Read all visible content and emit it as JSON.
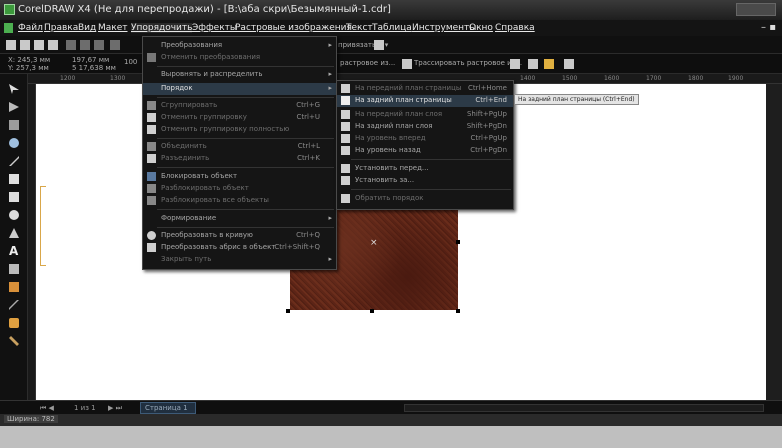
{
  "window": {
    "title": "CorelDRAW X4 (Не для перепродажи) - [B:\\аба скри\\Безымянный-1.cdr]"
  },
  "menubar": {
    "items": [
      "Файл",
      "Правка",
      "Вид",
      "Макет",
      "Упорядочить",
      "Эффекты",
      "Растровые изображения",
      "Текст",
      "Таблица",
      "Инструменты",
      "Окно",
      "Справка"
    ],
    "minimize": "– ▪"
  },
  "toolbar": {
    "x_field": "X: 245,3 мм",
    "y_field": "Y: 257,3 мм",
    "w_field": "197,67 мм",
    "h_field": "5 17,638 мм",
    "scale": "100",
    "snap_label": "привязать к ▾",
    "trace_left": "растровое из...",
    "trace_label": "Трассировать растровое из..."
  },
  "ruler": {
    "ticks": [
      "1200",
      "1300",
      "1400",
      "1500",
      "1600",
      "1700",
      "1800",
      "1900",
      "2000",
      "2100"
    ]
  },
  "arrange_menu": {
    "items": [
      {
        "label": "Преобразования",
        "shortcut": "",
        "submenu": true,
        "disabled": false
      },
      {
        "label": "Отменить преобразования",
        "shortcut": "",
        "submenu": false,
        "disabled": true
      },
      {
        "label": "Выровнять и распределить",
        "shortcut": "",
        "submenu": true,
        "disabled": false
      },
      {
        "label": "Порядок",
        "shortcut": "",
        "submenu": true,
        "disabled": false,
        "highlighted": true
      },
      {
        "label": "Сгруппировать",
        "shortcut": "Ctrl+G",
        "submenu": false,
        "disabled": true
      },
      {
        "label": "Отменить группировку",
        "shortcut": "Ctrl+U",
        "submenu": false,
        "disabled": true
      },
      {
        "label": "Отменить группировку полностью",
        "shortcut": "",
        "submenu": false,
        "disabled": true
      },
      {
        "label": "Объединить",
        "shortcut": "Ctrl+L",
        "submenu": false,
        "disabled": true
      },
      {
        "label": "Разъединить",
        "shortcut": "Ctrl+K",
        "submenu": false,
        "disabled": true
      },
      {
        "label": "Блокировать объект",
        "shortcut": "",
        "submenu": false,
        "disabled": false
      },
      {
        "label": "Разблокировать объект",
        "shortcut": "",
        "submenu": false,
        "disabled": true
      },
      {
        "label": "Разблокировать все объекты",
        "shortcut": "",
        "submenu": false,
        "disabled": true
      },
      {
        "label": "Формирование",
        "shortcut": "",
        "submenu": true,
        "disabled": false
      },
      {
        "label": "Преобразовать в кривую",
        "shortcut": "Ctrl+Q",
        "submenu": false,
        "disabled": false
      },
      {
        "label": "Преобразовать абрис в объект",
        "shortcut": "Ctrl+Shift+Q",
        "submenu": false,
        "disabled": false
      },
      {
        "label": "Закрыть путь",
        "shortcut": "",
        "submenu": true,
        "disabled": true
      }
    ]
  },
  "order_submenu": {
    "items": [
      {
        "label": "На передний план страницы",
        "shortcut": "Ctrl+Home",
        "disabled": true
      },
      {
        "label": "На задний план страницы",
        "shortcut": "Ctrl+End",
        "disabled": false,
        "highlighted": true
      },
      {
        "label": "На передний план слоя",
        "shortcut": "Shift+PgUp",
        "disabled": true
      },
      {
        "label": "На задний план слоя",
        "shortcut": "Shift+PgDn",
        "disabled": false
      },
      {
        "label": "На уровень вперед",
        "shortcut": "Ctrl+PgUp",
        "disabled": true
      },
      {
        "label": "На уровень назад",
        "shortcut": "Ctrl+PgDn",
        "disabled": false
      },
      {
        "label": "Установить перед...",
        "shortcut": "",
        "disabled": false
      },
      {
        "label": "Установить за...",
        "shortcut": "",
        "disabled": false
      },
      {
        "label": "Обратить порядок",
        "shortcut": "",
        "disabled": true
      }
    ]
  },
  "tooltip": "На задний план страницы (Ctrl+End)",
  "pagebar": {
    "page_count": "1 из 1",
    "page_tab": "Страница 1"
  },
  "status": {
    "text": "Ширина: 782"
  },
  "colors": {
    "accent": "#2c3a47",
    "image": "#5c2416",
    "menu_bg": "#151515"
  }
}
